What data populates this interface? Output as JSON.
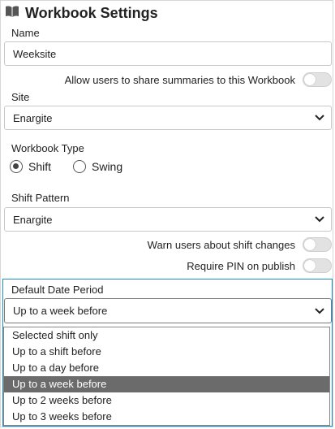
{
  "header": {
    "title": "Workbook Settings",
    "icon": "book-icon"
  },
  "name_field": {
    "label": "Name",
    "value": "Weeksite"
  },
  "share_toggle": {
    "label": "Allow users to share summaries to this Workbook",
    "on": false
  },
  "site": {
    "label": "Site",
    "selected": "Enargite"
  },
  "workbook_type": {
    "label": "Workbook Type",
    "options": [
      {
        "label": "Shift",
        "checked": true
      },
      {
        "label": "Swing",
        "checked": false
      }
    ]
  },
  "shift_pattern": {
    "label": "Shift Pattern",
    "selected": "Enargite"
  },
  "warn_toggle": {
    "label": "Warn users about shift changes",
    "on": false
  },
  "pin_toggle": {
    "label": "Require PIN on publish",
    "on": false
  },
  "default_date_period": {
    "label": "Default Date Period",
    "selected": "Up to a week before",
    "options": [
      "Selected shift only",
      "Up to a shift before",
      "Up to a day before",
      "Up to a week before",
      "Up to 2 weeks before",
      "Up to 3 weeks before"
    ],
    "highlighted_index": 3
  },
  "colors": {
    "accent_border": "#1e8fc6",
    "highlight": "#6b6b6b"
  }
}
